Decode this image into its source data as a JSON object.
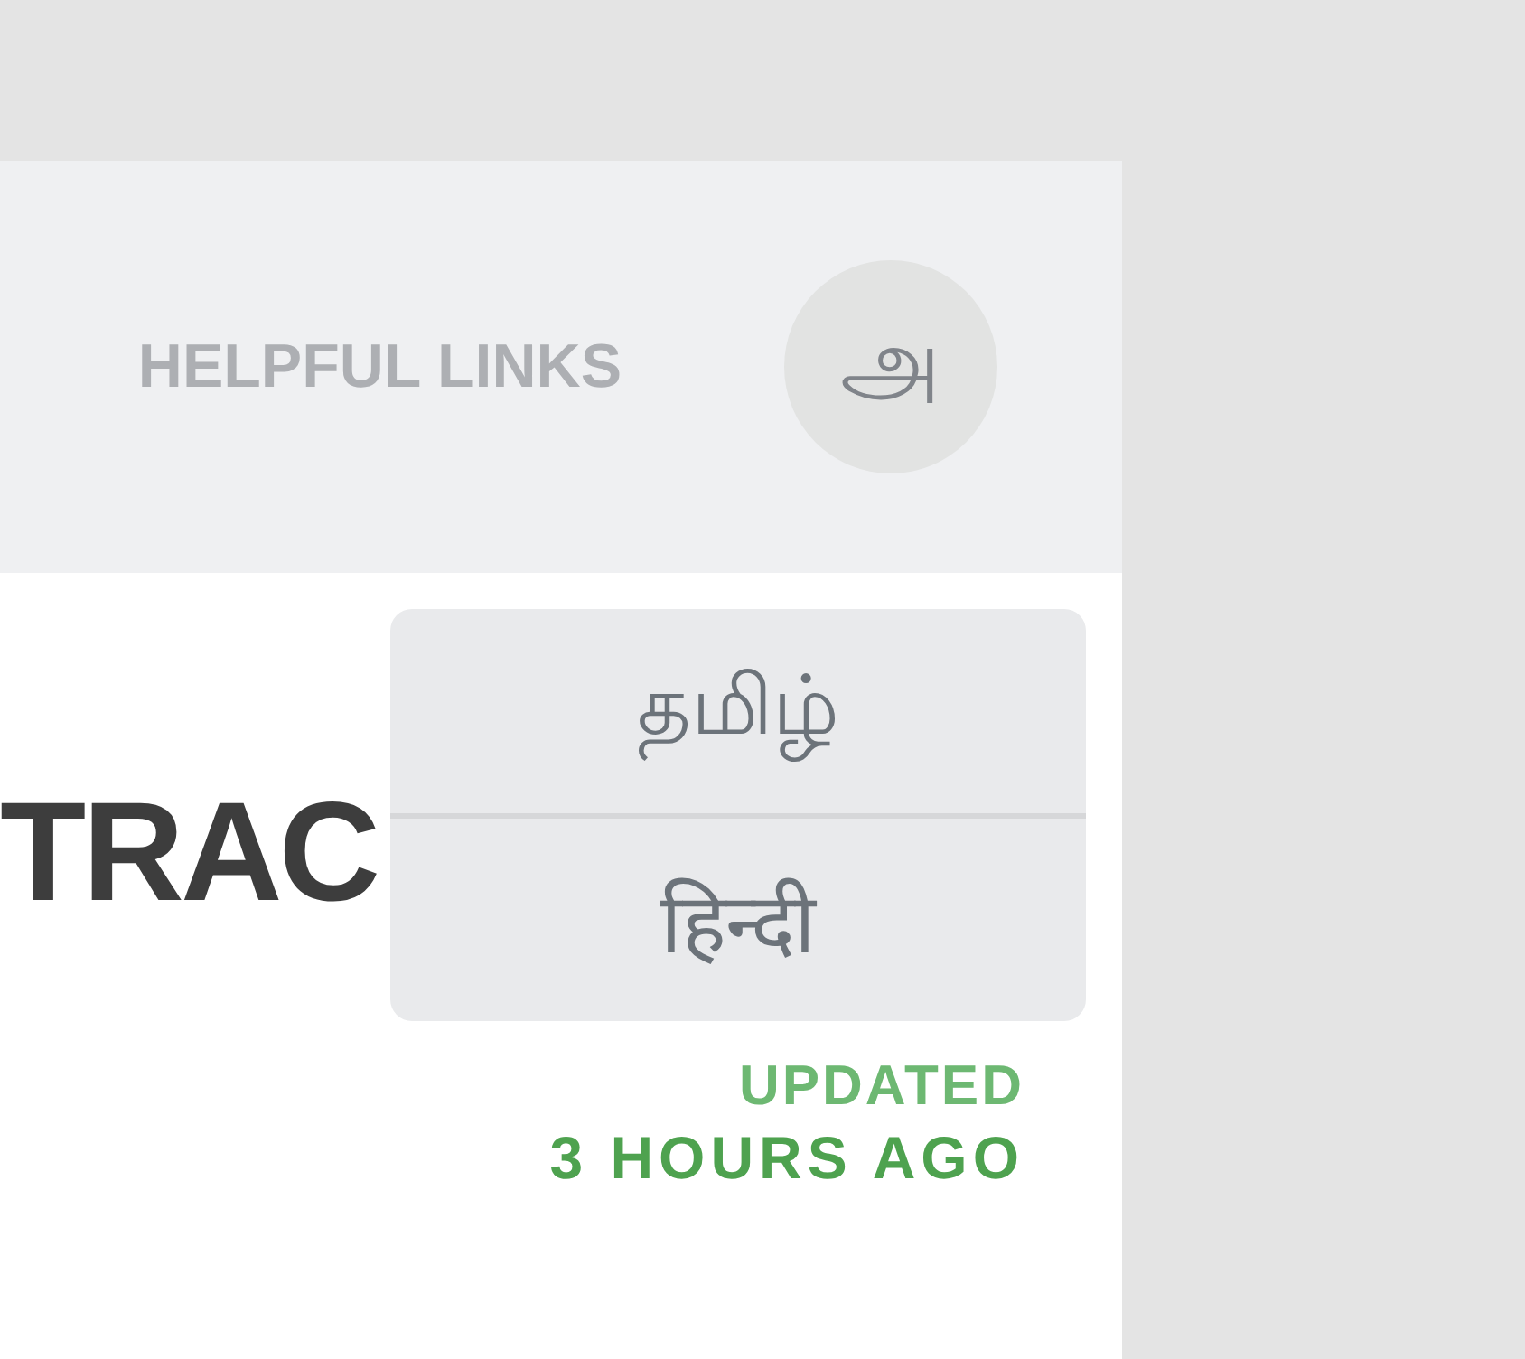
{
  "header": {
    "helpful_links": "HELPFUL LINKS",
    "language_button": "அ"
  },
  "title": "TRAC",
  "language_menu": {
    "items": [
      {
        "label": "தமிழ்"
      },
      {
        "label": "हिन्दी"
      }
    ]
  },
  "updated": {
    "label": "UPDATED",
    "time": "3 HOURS AGO"
  }
}
